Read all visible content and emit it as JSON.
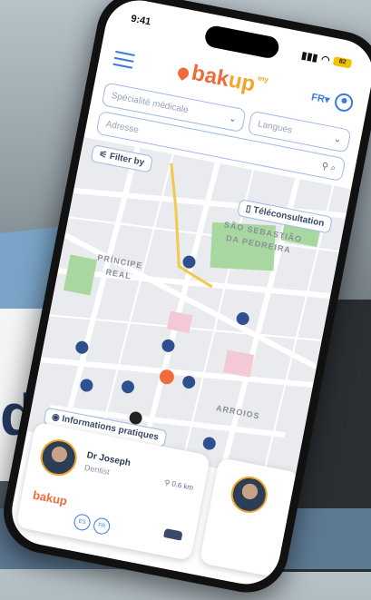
{
  "status_bar": {
    "time": "9:41",
    "battery": "82"
  },
  "header": {
    "lang_label": "FR",
    "logo_main": "bak",
    "logo_accent": "up",
    "logo_small": "my"
  },
  "filters": {
    "specialty_placeholder": "Spécialité médicale",
    "language_placeholder": "Langues",
    "address_placeholder": "Adresse"
  },
  "map": {
    "filter_chip": "Filter by",
    "teleconsult_chip": "Téléconsultation",
    "info_chip": "Informations pratiques",
    "labels": [
      "SÃO SEBASTIÃO",
      "DA PEDREIRA",
      "ARROIOS",
      "PRÍNCIPE",
      "REAL"
    ]
  },
  "card": {
    "doctor_name": "Dr Joseph",
    "doctor_role": "Dentist",
    "distance": "0.6 km",
    "brand": "bakup",
    "langs": [
      "ES",
      "FR"
    ]
  },
  "background": {
    "big_letter": "d"
  },
  "colors": {
    "accent_blue": "#3b7be0",
    "brand_orange": "#ef6b3b",
    "brand_yellow": "#f4a52b"
  }
}
